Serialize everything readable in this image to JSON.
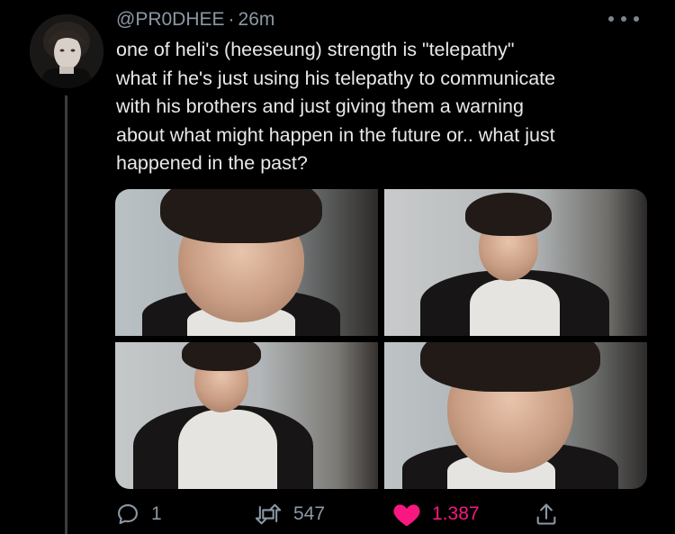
{
  "tweet": {
    "handle": "@PR0DHEE",
    "separator": "·",
    "time": "26m",
    "text": "one of heli's (heeseung) strength is \"telepathy\"\nwhat if he's just using his telepathy to communicate\nwith his brothers and just giving them a warning\nabout what might happen in the future or.. what just\nhappened in the past?"
  },
  "actions": {
    "reply_count": "1",
    "retweet_count": "547",
    "like_count": "1.387"
  },
  "icons": {
    "avatar": "user-avatar-photo",
    "more": "more-options-icon",
    "reply": "reply-bubble-icon",
    "retweet": "retweet-icon",
    "like": "heart-icon",
    "share": "share-icon"
  },
  "colors": {
    "background": "#000000",
    "text": "#e7e9ea",
    "secondary": "#8b98a5",
    "like": "#f91880",
    "thread_line": "#3a3d40"
  },
  "media": {
    "count": 4,
    "layout": "2x2 grid"
  }
}
